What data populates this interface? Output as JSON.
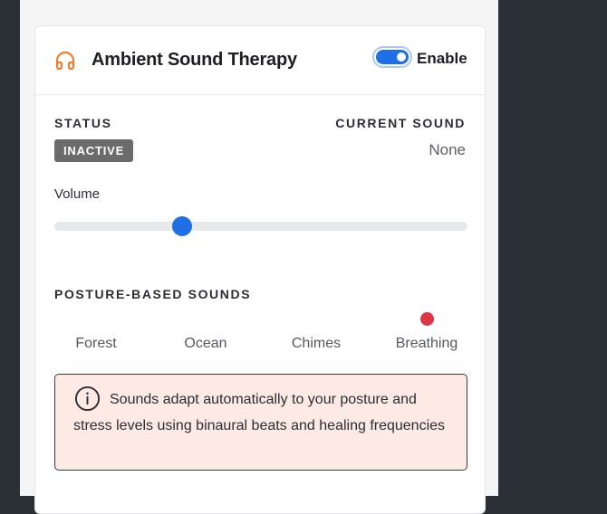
{
  "card": {
    "title": "Ambient Sound Therapy",
    "icon": "headphones-icon",
    "enable_label": "Enable",
    "enabled": true
  },
  "status": {
    "label": "STATUS",
    "value": "INACTIVE"
  },
  "current_sound": {
    "label": "CURRENT SOUND",
    "value": "None"
  },
  "volume": {
    "label": "Volume",
    "value_fraction": 0.31
  },
  "posture_sounds": {
    "label": "POSTURE-BASED SOUNDS",
    "items": [
      {
        "label": "Forest",
        "indicator": false
      },
      {
        "label": "Ocean",
        "indicator": false
      },
      {
        "label": "Chimes",
        "indicator": false
      },
      {
        "label": "Breathing",
        "indicator": true
      }
    ]
  },
  "info": {
    "icon": "info-icon",
    "text": "Sounds adapt automatically to your posture and stress levels using binaural beats and healing frequencies"
  },
  "colors": {
    "accent": "#1f6fe8",
    "header_icon": "#f07d2a",
    "indicator_dot": "#dc3545",
    "info_bg": "#fdeae4",
    "badge_bg": "#6b6b6b"
  }
}
